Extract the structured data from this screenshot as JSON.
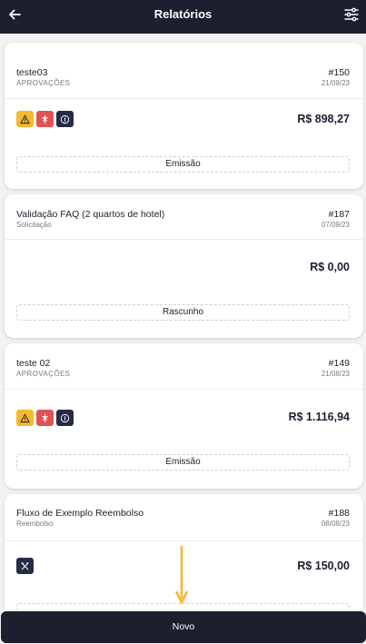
{
  "header": {
    "title": "Relatórios",
    "back_icon": "arrow-left-icon",
    "filter_icon": "sliders-icon"
  },
  "reports": [
    {
      "name": "teste03",
      "subtitle": "APROVAÇÕES",
      "number": "#150",
      "date": "21/09/23",
      "icons": [
        "warning-icon",
        "medical-icon",
        "coin-icon"
      ],
      "amount": "R$ 898,27",
      "status": "Emissão"
    },
    {
      "name": "Validação FAQ (2 quartos de hotel)",
      "subtitle": "Solicitação",
      "number": "#187",
      "date": "07/09/23",
      "icons": [],
      "amount": "R$ 0,00",
      "status": "Rascunho"
    },
    {
      "name": "teste 02",
      "subtitle": "APROVAÇÕES",
      "number": "#149",
      "date": "21/08/23",
      "icons": [
        "warning-icon",
        "medical-icon",
        "coin-icon"
      ],
      "amount": "R$ 1.116,94",
      "status": "Emissão"
    },
    {
      "name": "Fluxo de Exemplo Reembolso",
      "subtitle": "Reembolso",
      "number": "#188",
      "date": "08/08/23",
      "icons": [
        "utensils-icon"
      ],
      "amount": "R$ 150,00",
      "status": ""
    }
  ],
  "footer": {
    "new_button": "Novo"
  },
  "colors": {
    "dark": "#1b1f2e",
    "warning": "#f5b82e",
    "danger": "#e15353",
    "annotation_arrow": "#f5b82e"
  }
}
